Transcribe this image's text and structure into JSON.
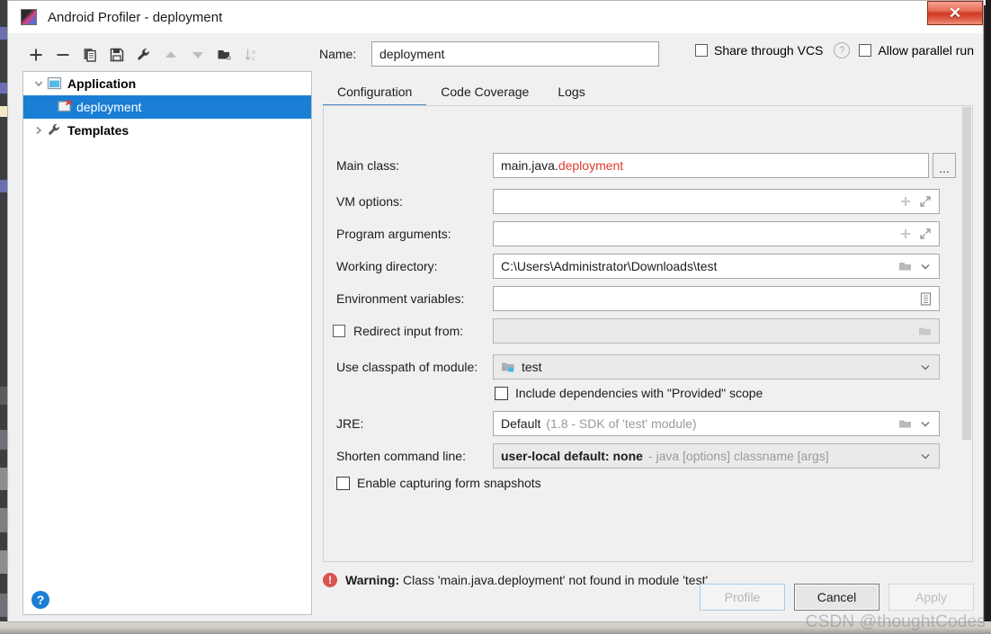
{
  "window": {
    "title": "Android Profiler - deployment",
    "app_icon": "android-profiler-icon",
    "close_label": "✕"
  },
  "toolbar": {
    "buttons": [
      {
        "name": "add-button",
        "icon": "plus-icon",
        "tooltip": "Add New Configuration"
      },
      {
        "name": "remove-button",
        "icon": "minus-icon",
        "tooltip": "Remove Configuration"
      },
      {
        "name": "copy-button",
        "icon": "copy-icon",
        "tooltip": "Copy Configuration"
      },
      {
        "name": "save-button",
        "icon": "save-icon",
        "tooltip": "Save Configuration"
      },
      {
        "name": "edit-templates-button",
        "icon": "wrench-icon",
        "tooltip": "Edit Templates"
      },
      {
        "name": "move-up-button",
        "icon": "arrow-up-icon",
        "tooltip": "Move Up"
      },
      {
        "name": "move-down-button",
        "icon": "arrow-down-icon",
        "tooltip": "Move Down"
      },
      {
        "name": "new-folder-button",
        "icon": "new-folder-icon",
        "tooltip": "Create New Folder"
      },
      {
        "name": "sort-button",
        "icon": "sort-az-icon",
        "tooltip": "Sort Configurations"
      }
    ]
  },
  "tree": {
    "nodes": [
      {
        "label": "Application",
        "icon": "application-node-icon",
        "twisty": "chevron-down-icon",
        "level": 0,
        "selected": false,
        "bold": true
      },
      {
        "label": "deployment",
        "icon": "config-error-icon",
        "twisty": "",
        "level": 1,
        "selected": true,
        "bold": false
      },
      {
        "label": "Templates",
        "icon": "wrench-icon",
        "twisty": "chevron-right-icon",
        "level": 0,
        "selected": false,
        "bold": true
      }
    ]
  },
  "name_row": {
    "label": "Name:",
    "value": "deployment",
    "placeholder": ""
  },
  "top_options": {
    "share_vcs_label": "Share through VCS",
    "share_vcs_checked": false,
    "help_icon": "help-circle-icon",
    "allow_parallel_label": "Allow parallel run",
    "allow_parallel_checked": false
  },
  "tabs": [
    {
      "label": "Configuration",
      "active": true
    },
    {
      "label": "Code Coverage",
      "active": false
    },
    {
      "label": "Logs",
      "active": false
    }
  ],
  "form": {
    "main_class": {
      "label": "Main class:",
      "value_plain": "main.java.",
      "value_red": "deployment",
      "browse_label": "...",
      "browse_icon": "ellipsis-icon"
    },
    "vm_options": {
      "label": "VM options:",
      "value": "",
      "icons": [
        "insert-macro-icon",
        "expand-icon"
      ]
    },
    "program_arguments": {
      "label": "Program arguments:",
      "value": "",
      "icons": [
        "insert-macro-icon",
        "expand-icon"
      ]
    },
    "working_directory": {
      "label": "Working directory:",
      "value": "C:\\Users\\Administrator\\Downloads\\test",
      "icons": [
        "folder-icon",
        "chevron-down-icon"
      ]
    },
    "environment_variables": {
      "label": "Environment variables:",
      "value": "",
      "icons": [
        "env-list-icon"
      ]
    },
    "redirect_input": {
      "label": "Redirect input from:",
      "checked": false,
      "value": "",
      "icons": [
        "folder-icon"
      ]
    },
    "classpath_module": {
      "label": "Use classpath of module:",
      "value": "test",
      "module_icon": "module-folder-icon",
      "icons": [
        "chevron-down-icon"
      ]
    },
    "include_provided": {
      "label": "Include dependencies with \"Provided\" scope",
      "checked": false
    },
    "jre": {
      "label": "JRE:",
      "value_plain": "Default",
      "value_grey": "(1.8 - SDK of 'test' module)",
      "icons": [
        "folder-icon",
        "chevron-down-icon"
      ]
    },
    "shorten_command_line": {
      "label": "Shorten command line:",
      "value_bold": "user-local default: none",
      "value_grey": "- java [options] classname [args]",
      "icons": [
        "chevron-down-icon"
      ]
    },
    "form_snapshots": {
      "label": "Enable capturing form snapshots",
      "checked": false
    }
  },
  "warning": {
    "icon": "error-circle-icon",
    "prefix": "Warning:",
    "message": "Class 'main.java.deployment' not found in module 'test'"
  },
  "footer": {
    "help_label": "?",
    "buttons": [
      {
        "label": "Profile",
        "state": "disabled-primary",
        "name": "profile-button"
      },
      {
        "label": "Cancel",
        "state": "default",
        "name": "cancel-button"
      },
      {
        "label": "Apply",
        "state": "disabled",
        "name": "apply-button"
      }
    ]
  },
  "watermark": "CSDN @thoughtCodes",
  "colors": {
    "selection_blue": "#1a7fd4",
    "tab_accent": "#4a88c7",
    "error_red": "#e03a2f",
    "warning_red": "#d9534f",
    "dialog_bg": "#f0f0f0",
    "close_red": "#cf3822"
  }
}
